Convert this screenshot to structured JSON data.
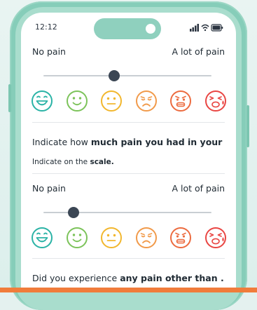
{
  "status_bar": {
    "time": "12:12"
  },
  "slider_1": {
    "min_label": "No pain",
    "max_label": "A lot of pain",
    "value": 0.42
  },
  "slider_2": {
    "min_label": "No pain",
    "max_label": "A lot of pain",
    "value": 0.18
  },
  "question_2": {
    "text_pre": "Indicate how ",
    "text_bold": "much pain you had in your ...",
    "hint_pre": "Indicate on the ",
    "hint_bold": "scale."
  },
  "question_3": {
    "text_pre": "Did you experience ",
    "text_bold": "any pain other than ..."
  },
  "faces": [
    {
      "icon": "laughing-face-icon",
      "color": "#2bb3a6"
    },
    {
      "icon": "smiling-face-icon",
      "color": "#7cc35a"
    },
    {
      "icon": "neutral-face-icon",
      "color": "#f2b72e"
    },
    {
      "icon": "sad-face-icon",
      "color": "#f19a4a"
    },
    {
      "icon": "grimacing-face-icon",
      "color": "#ec6b3f"
    },
    {
      "icon": "crying-face-icon",
      "color": "#e94643"
    }
  ],
  "colors": {
    "accent": "#86cdb9",
    "footer_bar": "#f07c3b",
    "thumb": "#3b4654"
  }
}
